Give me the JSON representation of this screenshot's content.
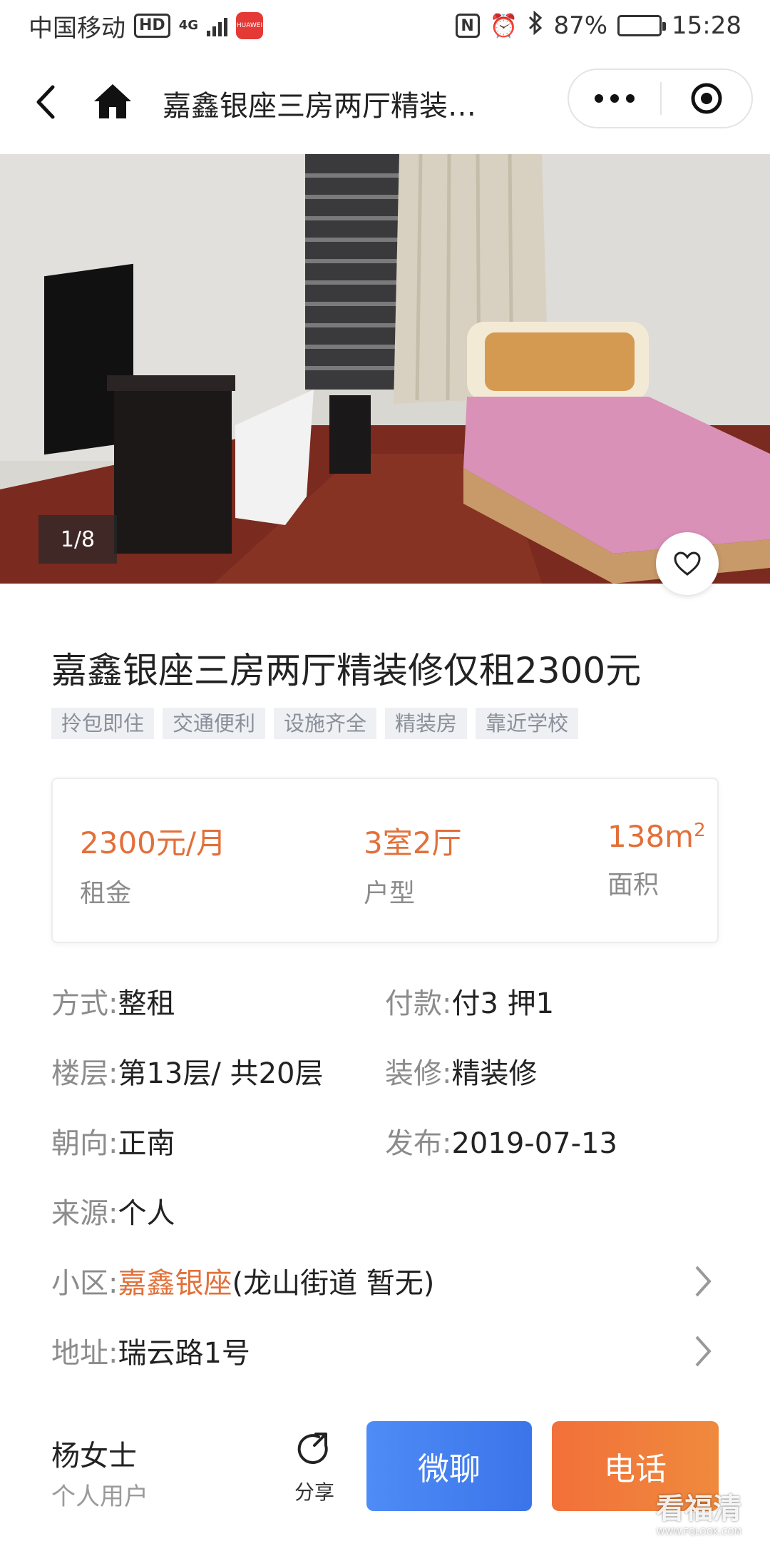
{
  "status_bar": {
    "carrier": "中国移动",
    "hd_badge": "HD",
    "network": "4G",
    "app_badge": "HUAWEI",
    "nfc": "N",
    "battery_percent": "87%",
    "battery_level": 0.87,
    "time": "15:28"
  },
  "nav": {
    "title": "嘉鑫银座三房两厅精装…"
  },
  "gallery": {
    "counter": "1/8"
  },
  "listing": {
    "title": "嘉鑫银座三房两厅精装修仅租2300元",
    "tags": [
      "拎包即住",
      "交通便利",
      "设施齐全",
      "精装房",
      "靠近学校"
    ]
  },
  "summary": {
    "rent_value": "2300元/月",
    "rent_label": "租金",
    "layout_value": "3室2厅",
    "layout_label": "户型",
    "area_value": "138m",
    "area_sup": "2",
    "area_label": "面积"
  },
  "details": {
    "mode_label": "方式:",
    "mode_value": "整租",
    "payment_label": "付款:",
    "payment_value": "付3  押1",
    "floor_label": "楼层:",
    "floor_value": "第13层/  共20层",
    "decor_label": "装修:",
    "decor_value": "精装修",
    "orientation_label": "朝向:",
    "orientation_value": "正南",
    "published_label": "发布:",
    "published_value": "2019-07-13",
    "source_label": "来源:",
    "source_value": "个人",
    "community_label": "小区:",
    "community_value": "嘉鑫银座",
    "community_extra": "(龙山街道  暂无)",
    "address_label": "地址:",
    "address_value": "瑞云路1号"
  },
  "bottom": {
    "owner_name": "杨女士",
    "owner_type": "个人用户",
    "share_label": "分享",
    "chat_label": "微聊",
    "call_label": "电话"
  },
  "watermark": {
    "text": "看福清",
    "url": "WWW.FQLOOK.COM"
  },
  "colors": {
    "accent_orange": "#e2703a",
    "chat_blue": "#3b74ea",
    "call_orange": "#f2703a"
  }
}
